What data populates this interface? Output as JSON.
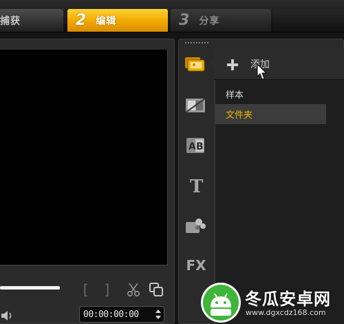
{
  "workflow_tabs": [
    {
      "number": "",
      "label": "捕获",
      "state": "normal"
    },
    {
      "number": "2",
      "label": "编辑",
      "state": "active"
    },
    {
      "number": "3",
      "label": "分享",
      "state": "normal"
    }
  ],
  "preview": {
    "scrubber_progress": 0.36,
    "mark_in": "[",
    "mark_out": "]",
    "timecode": "00:00:00:00",
    "icons": [
      "cut-icon",
      "copy-icon",
      "volume-icon",
      "spin-arrows-icon"
    ]
  },
  "library": {
    "toolbar_icons": [
      "media-icon",
      "transition-icon",
      "title-ab-icon",
      "text-t-icon",
      "effects-icon",
      "fx-icon"
    ],
    "fx_label": "FX",
    "add_label": "添加",
    "items": [
      {
        "label": "样本",
        "selected": false
      },
      {
        "label": "文件夹",
        "selected": true
      }
    ]
  },
  "watermark": {
    "title": "冬瓜安卓网",
    "url": "www.dgxcdz168.com"
  },
  "colors": {
    "accent": "#f0a800",
    "folder_text": "#f0b400",
    "watermark_green": "#3fb53a"
  }
}
